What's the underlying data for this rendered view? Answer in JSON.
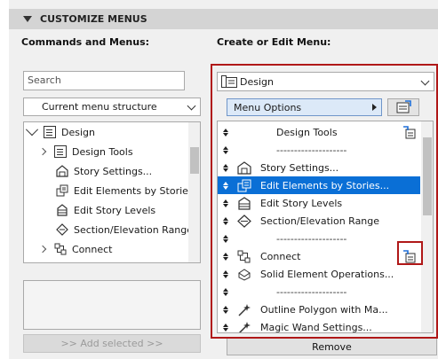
{
  "section": {
    "title": "CUSTOMIZE MENUS"
  },
  "left": {
    "heading": "Commands and Menus:",
    "search_placeholder": "Search",
    "structure_dropdown": "Current menu structure",
    "tree": [
      {
        "label": "Design",
        "expander": "expanded",
        "icon": "menu-icon"
      },
      {
        "label": "Design Tools",
        "expander": "collapsed",
        "icon": "menu-icon"
      },
      {
        "label": "Story Settings...",
        "expander": "none",
        "icon": "story-settings-icon"
      },
      {
        "label": "Edit Elements by Stories...",
        "expander": "none",
        "icon": "edit-elements-by-stories-icon"
      },
      {
        "label": "Edit Story Levels",
        "expander": "none",
        "icon": "edit-story-levels-icon"
      },
      {
        "label": "Section/Elevation Range",
        "expander": "none",
        "icon": "section-elevation-range-icon"
      },
      {
        "label": "Connect",
        "expander": "collapsed",
        "icon": "connect-icon"
      }
    ],
    "add_selected": ">> Add selected >>"
  },
  "right": {
    "heading": "Create or Edit Menu:",
    "menu_dropdown": "Design",
    "menu_options": "Menu Options",
    "items": [
      {
        "label": "Design Tools",
        "type": "submenu",
        "icon": ""
      },
      {
        "label": "--------------------",
        "type": "separator",
        "icon": ""
      },
      {
        "label": "Story Settings...",
        "type": "command",
        "icon": "story-settings-icon"
      },
      {
        "label": "Edit Elements by Stories...",
        "type": "command",
        "icon": "edit-elements-by-stories-icon",
        "selected": true
      },
      {
        "label": "Edit Story Levels",
        "type": "command",
        "icon": "edit-story-levels-icon"
      },
      {
        "label": "Section/Elevation Range",
        "type": "command",
        "icon": "section-elevation-range-icon"
      },
      {
        "label": "--------------------",
        "type": "separator",
        "icon": ""
      },
      {
        "label": "Connect",
        "type": "submenu",
        "icon": "connect-icon"
      },
      {
        "label": "Solid Element Operations...",
        "type": "command",
        "icon": "solid-element-operations-icon"
      },
      {
        "label": "--------------------",
        "type": "separator",
        "icon": ""
      },
      {
        "label": "Outline Polygon with Ma...",
        "type": "command",
        "icon": "magic-wand-icon"
      },
      {
        "label": "Magic Wand Settings...",
        "type": "command",
        "icon": "magic-wand-settings-icon"
      }
    ],
    "remove": "Remove"
  },
  "colors": {
    "highlight": "#0a6fd6",
    "callout_red": "#b01818",
    "header_bg": "#d4d4d4"
  }
}
